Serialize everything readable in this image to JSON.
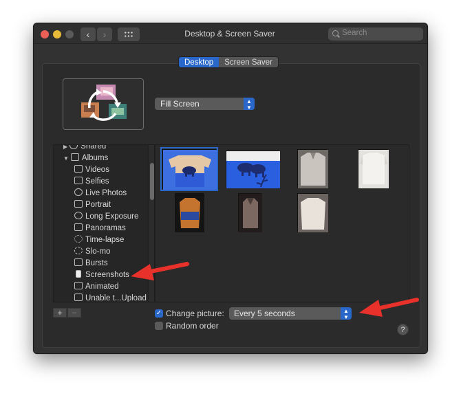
{
  "window": {
    "title": "Desktop & Screen Saver",
    "search_placeholder": "Search",
    "nav": {
      "back": "‹",
      "forward": "›"
    }
  },
  "tabs": [
    {
      "label": "Desktop",
      "selected": true
    },
    {
      "label": "Screen Saver",
      "selected": false
    }
  ],
  "fill_mode": {
    "value": "Fill Screen"
  },
  "sidebar": {
    "items": [
      {
        "label": "Shared",
        "icon": "cloud-icon",
        "disclosure": "▶"
      },
      {
        "label": "Albums",
        "icon": "folder-icon",
        "disclosure": "▼"
      },
      {
        "label": "Videos",
        "icon": "video-icon"
      },
      {
        "label": "Selfies",
        "icon": "camera-icon"
      },
      {
        "label": "Live Photos",
        "icon": "live-photo-icon"
      },
      {
        "label": "Portrait",
        "icon": "cube-icon"
      },
      {
        "label": "Long Exposure",
        "icon": "long-exposure-icon"
      },
      {
        "label": "Panoramas",
        "icon": "panorama-icon"
      },
      {
        "label": "Time-lapse",
        "icon": "timelapse-icon"
      },
      {
        "label": "Slo-mo",
        "icon": "slomo-icon"
      },
      {
        "label": "Bursts",
        "icon": "bursts-icon"
      },
      {
        "label": "Screenshots",
        "icon": "screenshot-icon"
      },
      {
        "label": "Animated",
        "icon": "animated-icon"
      },
      {
        "label": "Unable t...Upload",
        "icon": "unable-upload-icon"
      }
    ]
  },
  "photos": {
    "tiles": [
      {
        "name": "photo-blue-sweater-1",
        "selected": true
      },
      {
        "name": "photo-blue-sweater-2",
        "selected": false
      },
      {
        "name": "photo-grey-sweater",
        "selected": false
      },
      {
        "name": "photo-white-sweater",
        "selected": false
      },
      {
        "name": "photo-dark-sweater-1",
        "selected": false
      },
      {
        "name": "photo-dark-sweater-2",
        "selected": false
      },
      {
        "name": "photo-cream-sweater",
        "selected": false
      }
    ]
  },
  "bottom": {
    "add": "+",
    "remove": "−",
    "change_picture": {
      "label": "Change picture:",
      "checked": true
    },
    "interval": {
      "value": "Every 5 seconds"
    },
    "random_order": {
      "label": "Random order",
      "checked": false
    },
    "help": "?"
  },
  "colors": {
    "accent": "#2a67cb",
    "annotation_arrow": "#e8312a",
    "window_bg": "#323232"
  }
}
